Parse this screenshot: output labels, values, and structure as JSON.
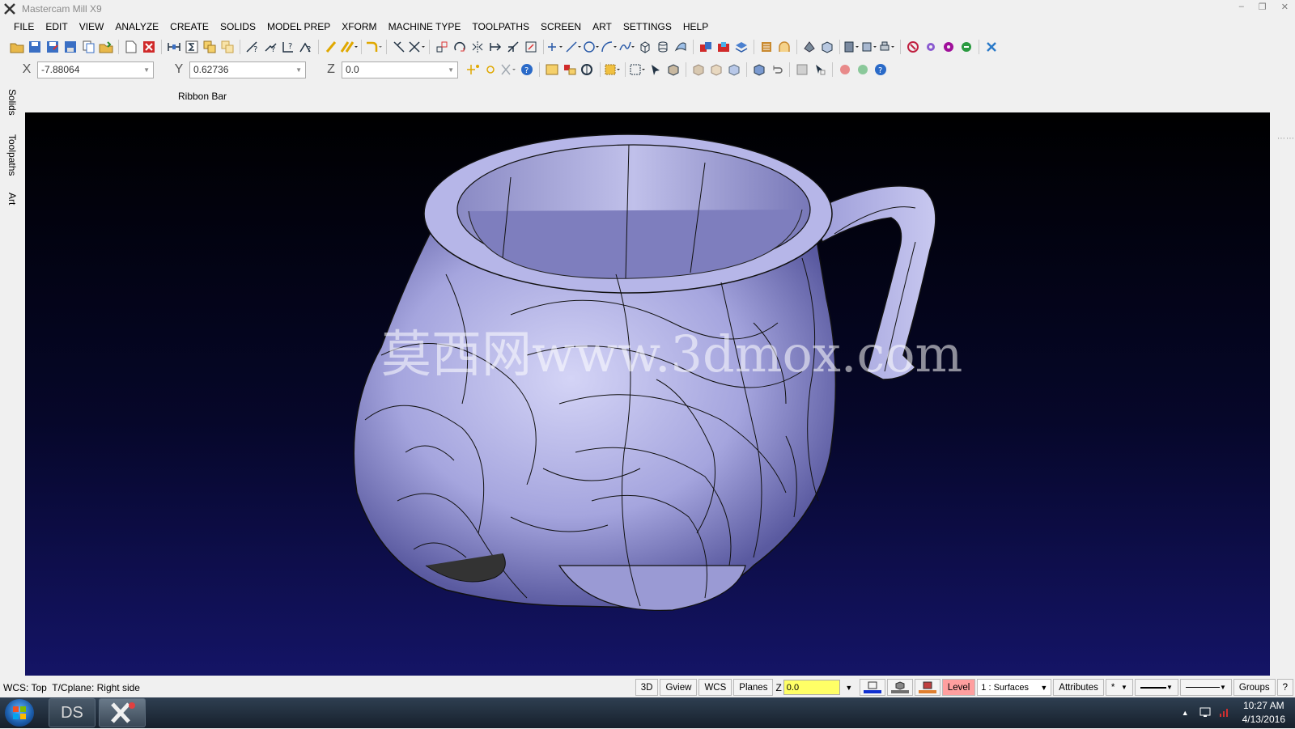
{
  "window": {
    "title": "Mastercam Mill X9"
  },
  "menu": [
    "FILE",
    "EDIT",
    "VIEW",
    "ANALYZE",
    "CREATE",
    "SOLIDS",
    "MODEL PREP",
    "XFORM",
    "MACHINE TYPE",
    "TOOLPATHS",
    "SCREEN",
    "ART",
    "SETTINGS",
    "HELP"
  ],
  "coords": {
    "x_label": "X",
    "x_value": "-7.88064",
    "y_label": "Y",
    "y_value": "0.62736",
    "z_label": "Z",
    "z_value": "0.0"
  },
  "ribbon_label": "Ribbon Bar",
  "left_tabs": [
    "Solids",
    "Toolpaths",
    "Art"
  ],
  "viewport": {
    "watermark": "莫西网www.3dmox.com",
    "bg_top": "#000000",
    "bg_bottom": "#141466",
    "model_color": "#a9a9e6"
  },
  "status": {
    "left_text": "WCS: Top  T/Cplane: Right side",
    "btn_3d": "3D",
    "btn_gview": "Gview",
    "btn_wcs": "WCS",
    "btn_planes": "Planes",
    "z_label": "Z",
    "z_value": "0.0",
    "level_label": "Level",
    "level_value": "1 : Surfaces",
    "attributes": "Attributes",
    "groups": "Groups",
    "help": "?",
    "point_style": "*"
  },
  "taskbar": {
    "ds_label": "DS",
    "time": "10:27 AM",
    "date": "4/13/2016"
  }
}
